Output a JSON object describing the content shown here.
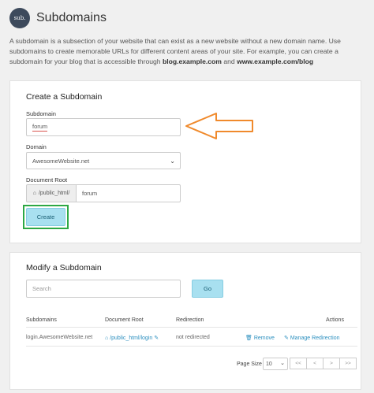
{
  "header": {
    "logo_text": "sub.",
    "title": "Subdomains"
  },
  "intro": {
    "text": "A subdomain is a subsection of your website that can exist as a new website without a new domain name. Use subdomains to create memorable URLs for different content areas of your site. For example, you can create a subdomain for your blog that is accessible through ",
    "example1": "blog.example.com",
    "and": " and ",
    "example2": "www.example.com/blog"
  },
  "create": {
    "heading": "Create a Subdomain",
    "subdomain_label": "Subdomain",
    "subdomain_value": "forum",
    "domain_label": "Domain",
    "domain_value": "AwesomeWebsite.net",
    "docroot_label": "Document Root",
    "docroot_prefix": "/public_html/",
    "docroot_value": "forum",
    "create_button": "Create"
  },
  "modify": {
    "heading": "Modify a Subdomain",
    "search_placeholder": "Search",
    "go_button": "Go",
    "columns": {
      "subdomains": "Subdomains",
      "document_root": "Document Root",
      "redirection": "Redirection",
      "actions": "Actions"
    },
    "rows": [
      {
        "subdomain": "login.AwesomeWebsite.net",
        "document_root": "/public_html/login",
        "redirection": "not redirected",
        "remove": "Remove",
        "manage": "Manage Redirection"
      }
    ],
    "page_size_label": "Page Size",
    "page_size_value": "10",
    "pager": [
      "<<",
      "<",
      ">",
      ">>"
    ]
  },
  "colors": {
    "accent": "#a8e0f0",
    "highlight_box": "#2da844",
    "arrow": "#f08a2c",
    "link": "#2b8fbf"
  }
}
